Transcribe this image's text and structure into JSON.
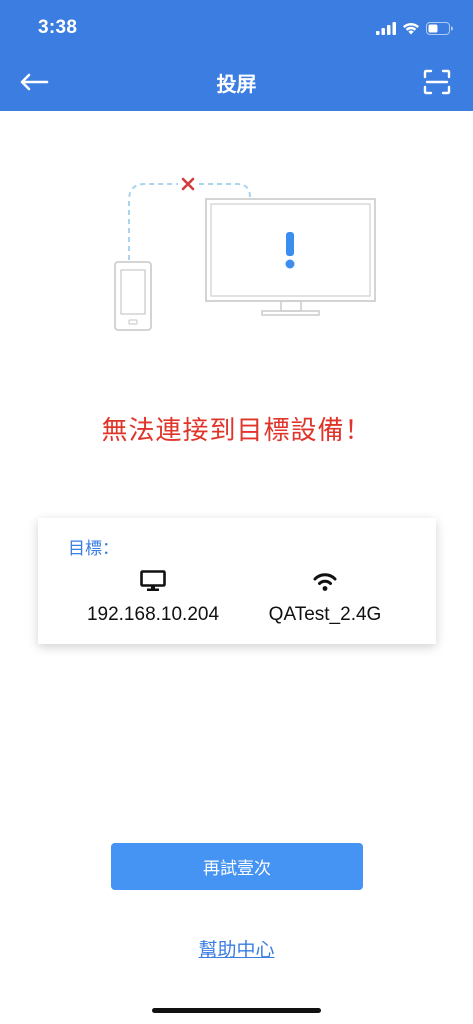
{
  "status_bar": {
    "time": "3:38"
  },
  "nav": {
    "title": "投屏",
    "back_icon": "arrow-left-icon",
    "scan_icon": "scan-frame-icon"
  },
  "illustration": {
    "icons": [
      "phone-icon",
      "monitor-icon",
      "disconnect-x-icon",
      "exclamation-icon"
    ]
  },
  "error": {
    "message": "無法連接到目標設備！"
  },
  "target": {
    "label": "目標：",
    "device_icon": "monitor-icon",
    "ip": "192.168.10.204",
    "wifi_icon": "wifi-icon",
    "ssid": "QATest_2.4G"
  },
  "actions": {
    "retry_label": "再試壹次",
    "help_label": "幫助中心"
  },
  "colors": {
    "header": "#3b7de1",
    "error": "#e0352b",
    "button": "#4593f3",
    "link": "#3b7de1"
  }
}
